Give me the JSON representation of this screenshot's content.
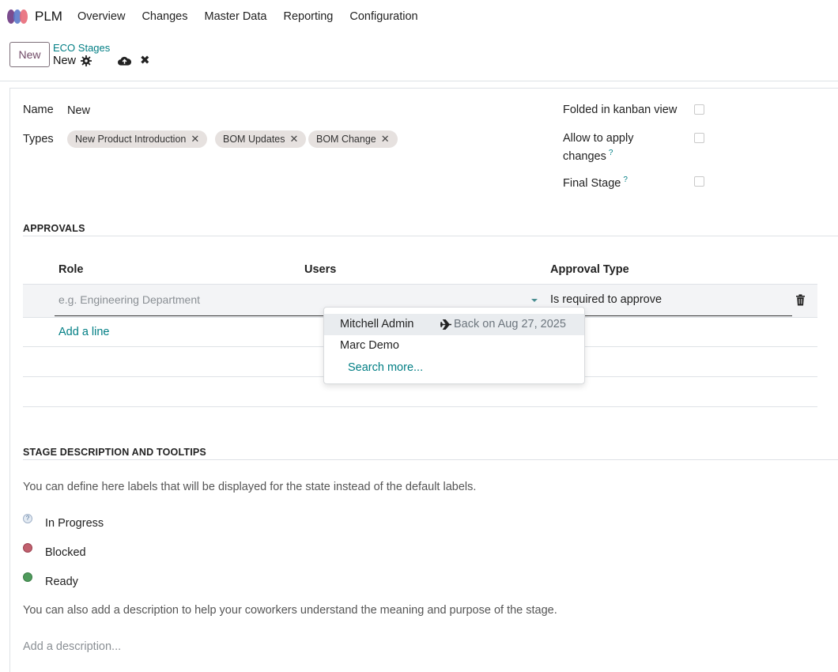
{
  "nav": {
    "app_name": "PLM",
    "menu": [
      "Overview",
      "Changes",
      "Master Data",
      "Reporting",
      "Configuration"
    ]
  },
  "control": {
    "new_label": "New",
    "breadcrumb_parent": "ECO Stages",
    "breadcrumb_current": "New"
  },
  "form": {
    "name_label": "Name",
    "name_value": "New",
    "types_label": "Types",
    "types": [
      "New Product Introduction",
      "BOM Updates",
      "BOM Change"
    ],
    "tag_remove": "✕",
    "folded_label": "Folded in kanban view",
    "allow_label_1": "Allow to apply",
    "allow_label_2": "changes",
    "final_label": "Final Stage",
    "help_mark": "?"
  },
  "approvals": {
    "title": "APPROVALS",
    "col_role": "Role",
    "col_users": "Users",
    "col_type": "Approval Type",
    "role_placeholder": "e.g. Engineering Department",
    "approval_type": "Is required to approve",
    "add_line": "Add a line"
  },
  "dropdown": {
    "items": [
      {
        "name": "Mitchell Admin",
        "status": "Back on Aug 27, 2025"
      },
      {
        "name": "Marc Demo",
        "status": ""
      }
    ],
    "search_more": "Search more..."
  },
  "stage_desc": {
    "title": "STAGE DESCRIPTION AND TOOLTIPS",
    "intro": "You can define here labels that will be displayed for the state instead of the default labels.",
    "states": [
      {
        "label": "In Progress",
        "color": "#dfe7f0"
      },
      {
        "label": "Blocked",
        "color": "#c1606e"
      },
      {
        "label": "Ready",
        "color": "#4f9b5c"
      }
    ],
    "more": "You can also add a description to help your coworkers understand the meaning and purpose of the stage.",
    "description_placeholder": "Add a description..."
  }
}
